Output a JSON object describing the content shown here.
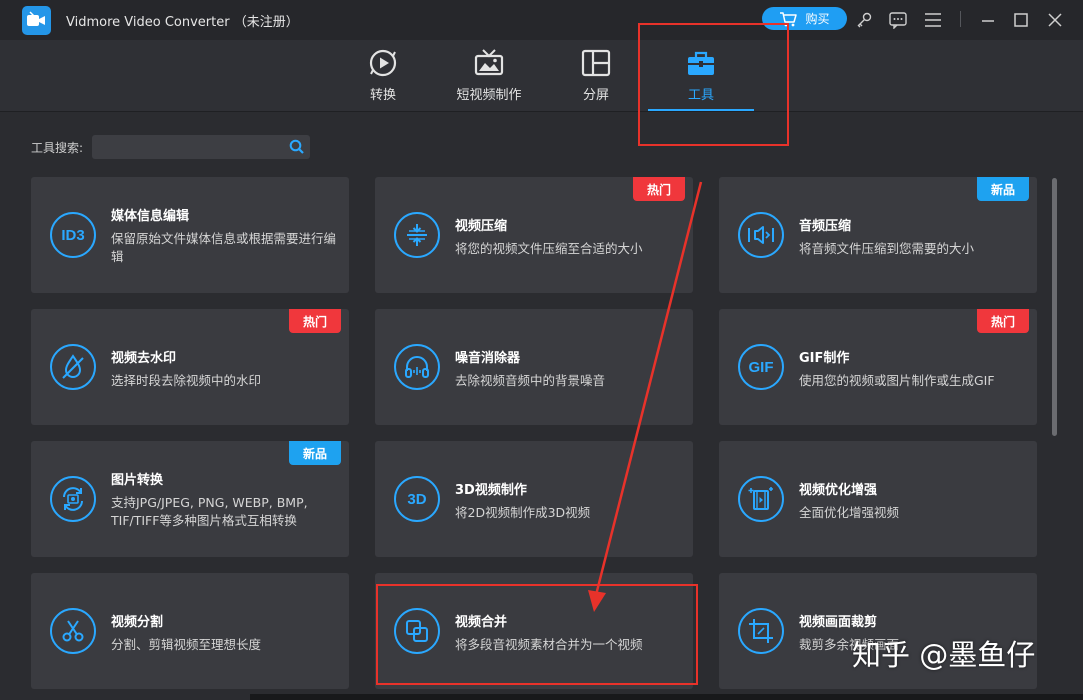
{
  "window": {
    "title": "Vidmore Video Converter （未注册）",
    "buy_label": "购买"
  },
  "nav": {
    "tabs": [
      {
        "label": "转换",
        "icon": "convert-icon"
      },
      {
        "label": "短视频制作",
        "icon": "mv-icon"
      },
      {
        "label": "分屏",
        "icon": "collage-icon"
      },
      {
        "label": "工具",
        "icon": "toolbox-icon",
        "active": true
      }
    ]
  },
  "search": {
    "label": "工具搜索:",
    "value": "",
    "placeholder": ""
  },
  "tools": [
    {
      "title": "媒体信息编辑",
      "desc": "保留原始文件媒体信息或根据需要进行编辑",
      "icon_text": "ID3",
      "badge": ""
    },
    {
      "title": "视频压缩",
      "desc": "将您的视频文件压缩至合适的大小",
      "icon": "compress-icon",
      "badge": "热门"
    },
    {
      "title": "音频压缩",
      "desc": "将音频文件压缩到您需要的大小",
      "icon": "audio-compress-icon",
      "badge": "新品"
    },
    {
      "title": "视频去水印",
      "desc": "选择时段去除视频中的水印",
      "icon": "watermark-remove-icon",
      "badge": "热门"
    },
    {
      "title": "噪音消除器",
      "desc": "去除视频音频中的背景噪音",
      "icon": "headphones-icon",
      "badge": ""
    },
    {
      "title": "GIF制作",
      "desc": "使用您的视频或图片制作或生成GIF",
      "icon_text": "GIF",
      "badge": "热门"
    },
    {
      "title": "图片转换",
      "desc": "支持JPG/JPEG, PNG, WEBP, BMP, TIF/TIFF等多种图片格式互相转换",
      "icon": "image-convert-icon",
      "badge": "新品"
    },
    {
      "title": "3D视频制作",
      "desc": "将2D视频制作成3D视频",
      "icon_text": "3D",
      "badge": ""
    },
    {
      "title": "视频优化增强",
      "desc": "全面优化增强视频",
      "icon": "enhance-icon",
      "badge": ""
    },
    {
      "title": "视频分割",
      "desc": "分割、剪辑视频至理想长度",
      "icon": "scissors-icon",
      "badge": ""
    },
    {
      "title": "视频合并",
      "desc": "将多段音视频素材合并为一个视频",
      "icon": "merge-icon",
      "badge": ""
    },
    {
      "title": "视频画面裁剪",
      "desc": "裁剪多余视频画面",
      "icon": "crop-icon",
      "badge": ""
    }
  ],
  "watermark": "知乎 @墨鱼仔",
  "colors": {
    "accent": "#2aa8ff",
    "hot": "#f0373c",
    "new": "#1ea2f0",
    "annotation": "#e8322a"
  }
}
